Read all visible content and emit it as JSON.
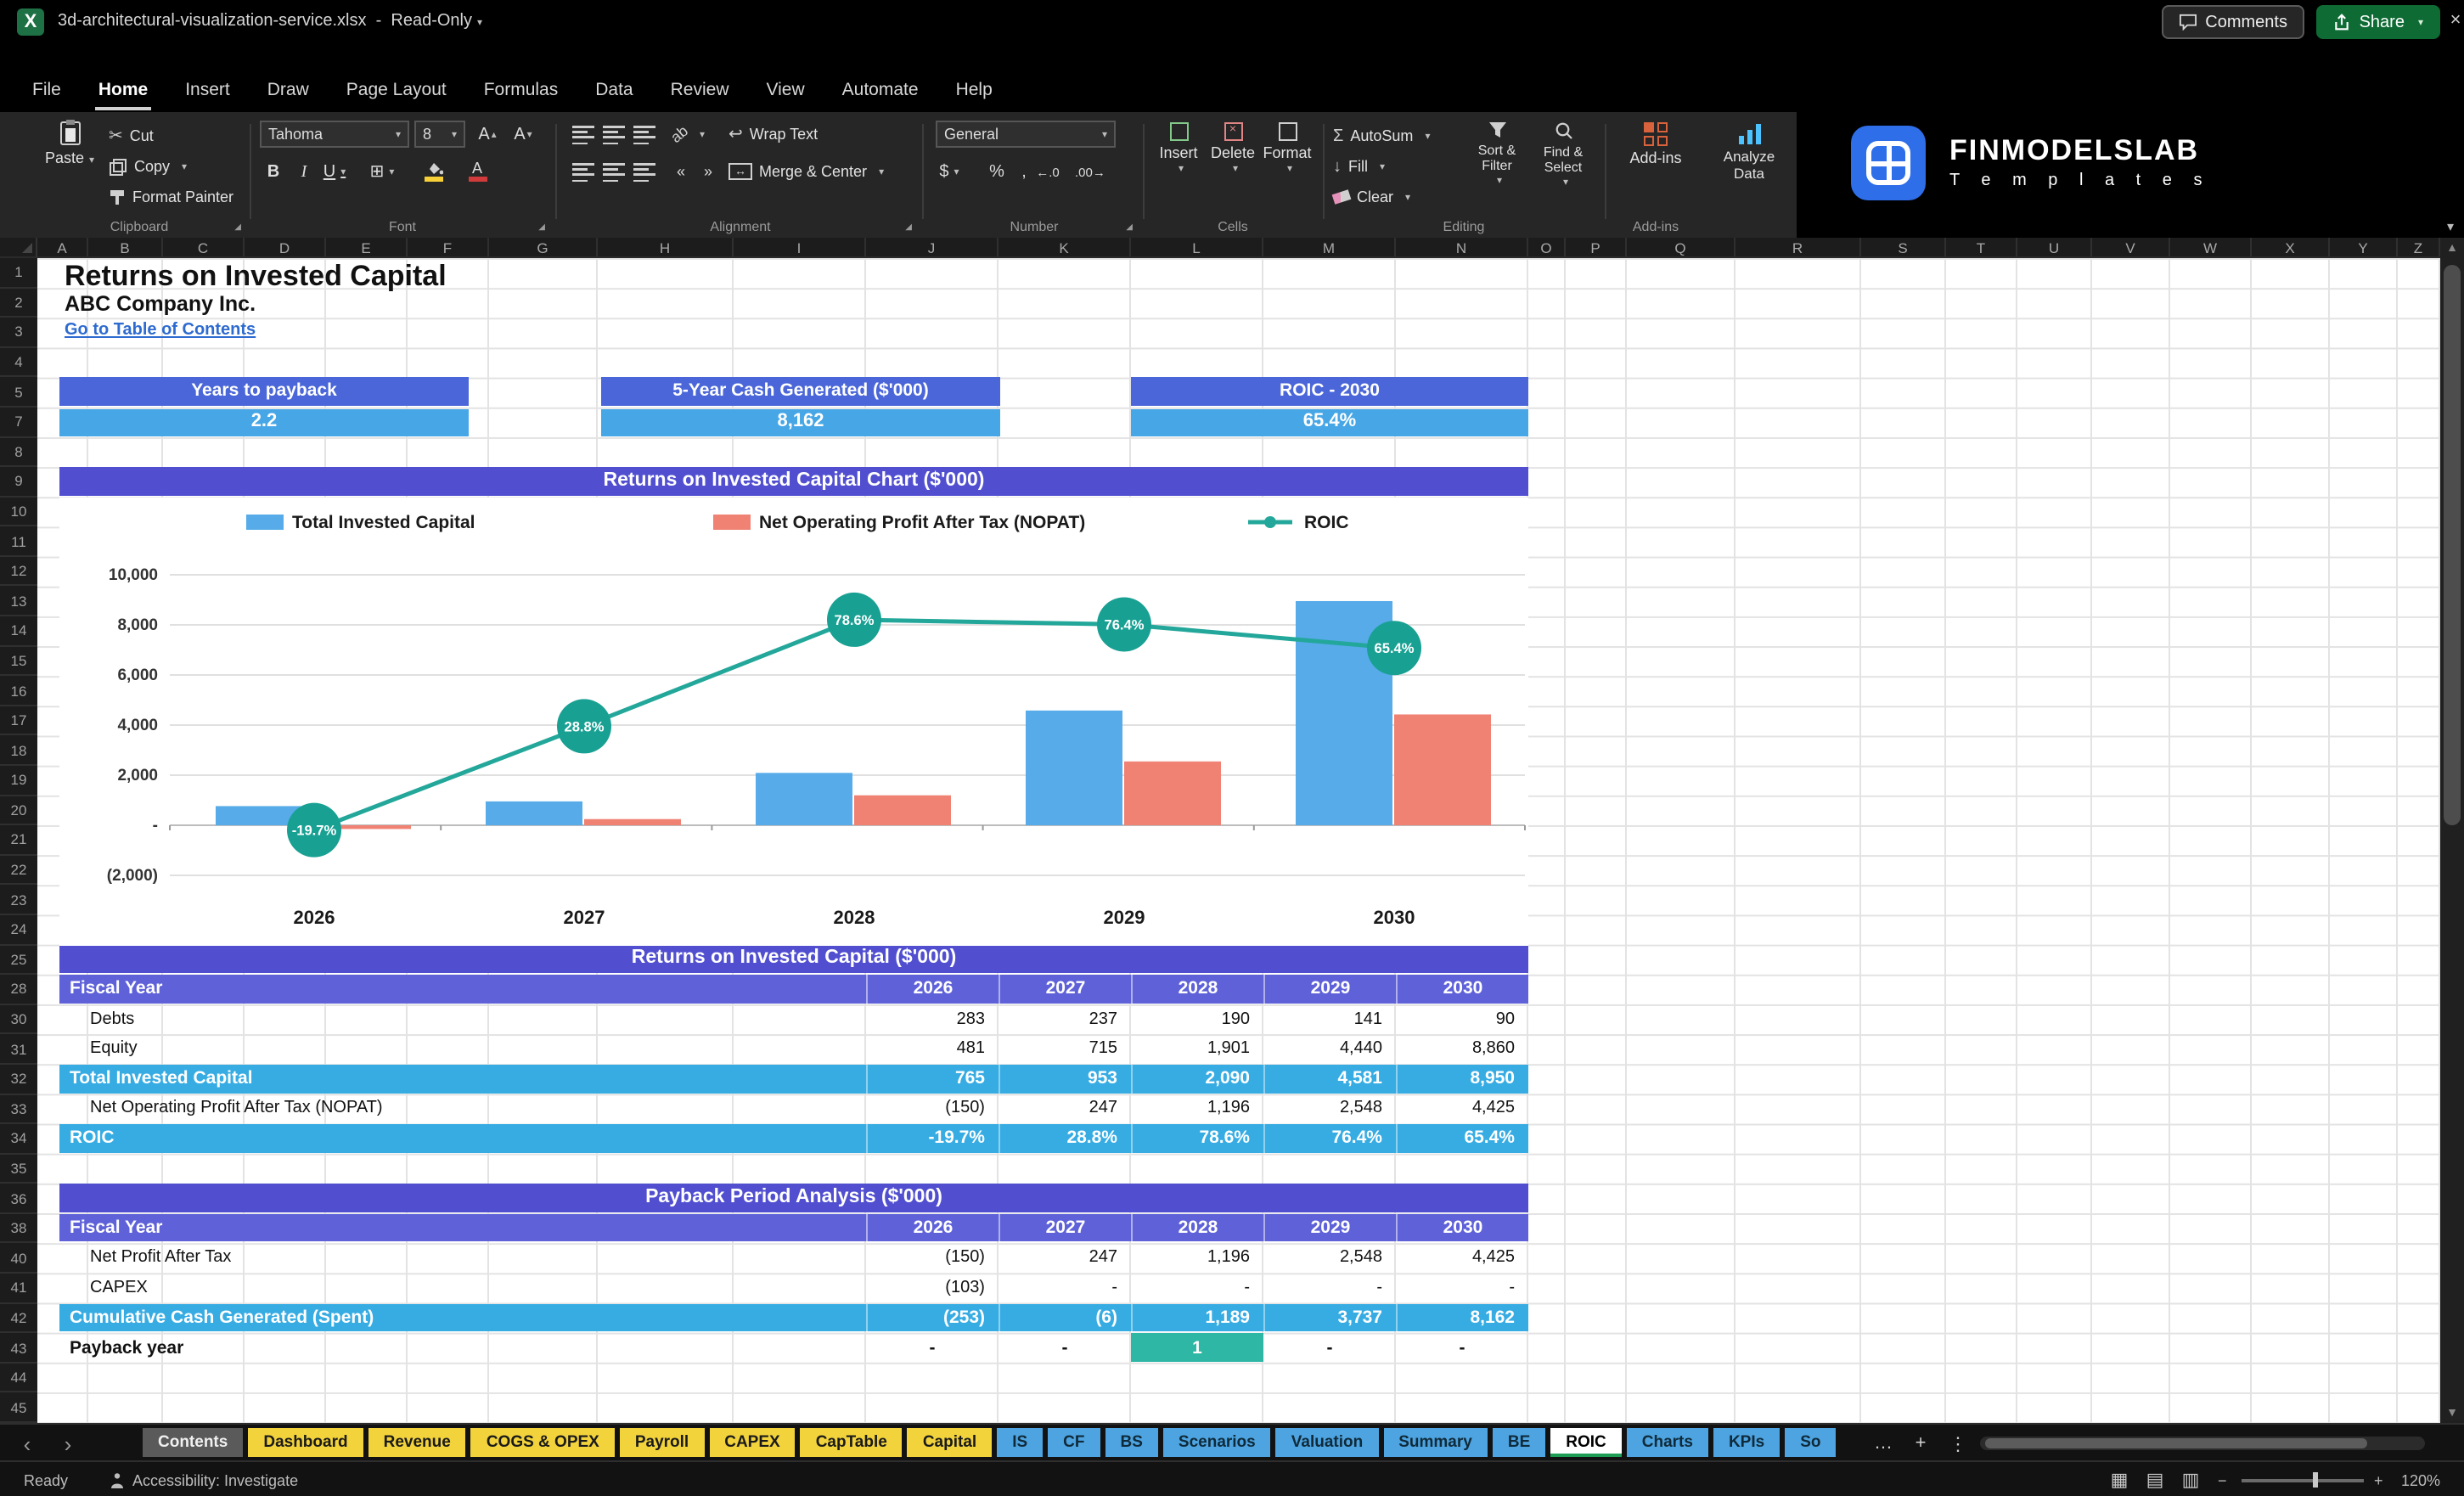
{
  "titlebar": {
    "filename": "3d-architectural-visualization-service.xlsx",
    "mode": "Read-Only"
  },
  "menubar": {
    "items": [
      "File",
      "Home",
      "Insert",
      "Draw",
      "Page Layout",
      "Formulas",
      "Data",
      "Review",
      "View",
      "Automate",
      "Help"
    ],
    "active_item": "Home",
    "comments": "Comments",
    "share": "Share"
  },
  "ribbon": {
    "clipboard": {
      "group": "Clipboard",
      "paste": "Paste",
      "cut": "Cut",
      "copy": "Copy",
      "format_painter": "Format Painter"
    },
    "font": {
      "group": "Font",
      "family": "Tahoma",
      "size": "8"
    },
    "alignment": {
      "group": "Alignment",
      "wrap_text": "Wrap Text",
      "merge_center": "Merge & Center"
    },
    "number": {
      "group": "Number",
      "format": "General",
      "currency": "$",
      "percent": "%",
      "comma": ",",
      "inc_decimal": "←.0",
      "dec_decimal": ".00→"
    },
    "cells": {
      "group": "Cells",
      "insert": "Insert",
      "delete": "Delete",
      "format": "Format"
    },
    "editing": {
      "group": "Editing",
      "autosum": "AutoSum",
      "fill": "Fill",
      "clear": "Clear",
      "sort_filter": "Sort & Filter",
      "find_select": "Find & Select"
    },
    "addins": {
      "group": "Add-ins",
      "addins": "Add-ins",
      "analyze": "Analyze Data"
    }
  },
  "brand": {
    "name": "FINMODELSLAB",
    "tagline": "T e m p l a t e s"
  },
  "sheet": {
    "columns": [
      "A",
      "B",
      "C",
      "D",
      "E",
      "F",
      "G",
      "H",
      "I",
      "J",
      "K",
      "L",
      "M",
      "N",
      "O",
      "P",
      "Q",
      "R",
      "S",
      "T",
      "U",
      "V",
      "W",
      "X",
      "Y",
      "Z"
    ],
    "visible_rows": [
      "1",
      "2",
      "3",
      "4",
      "5",
      "7",
      "8",
      "9",
      "10",
      "11",
      "12",
      "13",
      "14",
      "15",
      "16",
      "17",
      "18",
      "19",
      "20",
      "21",
      "22",
      "23",
      "24",
      "25",
      "28",
      "30",
      "31",
      "32",
      "33",
      "34",
      "35",
      "36",
      "38",
      "40",
      "41",
      "42",
      "43",
      "44",
      "45"
    ],
    "doc_title": "Returns on Invested Capital",
    "company": "ABC Company Inc.",
    "toc_link": "Go to Table of Contents",
    "kpis": [
      {
        "label": "Years to payback",
        "value": "2.2"
      },
      {
        "label": "5-Year Cash Generated ($'000)",
        "value": "8,162"
      },
      {
        "label": "ROIC - 2030",
        "value": "65.4%"
      }
    ],
    "roic_table": {
      "title": "Returns on Invested Capital ($'000)",
      "columns": [
        "Fiscal Year",
        "2026",
        "2027",
        "2028",
        "2029",
        "2030"
      ],
      "rows": [
        {
          "label": "Debts",
          "style": "normal",
          "values": [
            "283",
            "237",
            "190",
            "141",
            "90"
          ]
        },
        {
          "label": "Equity",
          "style": "normal",
          "values": [
            "481",
            "715",
            "1,901",
            "4,440",
            "8,860"
          ]
        },
        {
          "label": "Total Invested Capital",
          "style": "highlight",
          "values": [
            "765",
            "953",
            "2,090",
            "4,581",
            "8,950"
          ]
        },
        {
          "label": "Net Operating Profit After Tax (NOPAT)",
          "style": "normal",
          "values": [
            "(150)",
            "247",
            "1,196",
            "2,548",
            "4,425"
          ]
        },
        {
          "label": "ROIC",
          "style": "highlight",
          "values": [
            "-19.7%",
            "28.8%",
            "78.6%",
            "76.4%",
            "65.4%"
          ]
        }
      ]
    },
    "payback_table": {
      "title": "Payback Period Analysis ($'000)",
      "columns": [
        "Fiscal Year",
        "2026",
        "2027",
        "2028",
        "2029",
        "2030"
      ],
      "rows": [
        {
          "label": "Net Profit After Tax",
          "style": "normal",
          "values": [
            "(150)",
            "247",
            "1,196",
            "2,548",
            "4,425"
          ]
        },
        {
          "label": "CAPEX",
          "style": "normal",
          "values": [
            "(103)",
            "-",
            "-",
            "-",
            "-"
          ]
        },
        {
          "label": "Cumulative Cash Generated (Spent)",
          "style": "highlight",
          "values": [
            "(253)",
            "(6)",
            "1,189",
            "3,737",
            "8,162"
          ]
        },
        {
          "label": "Payback year",
          "style": "payback",
          "values": [
            "-",
            "-",
            "1",
            "-",
            "-"
          ],
          "highlight_col": 2
        }
      ]
    }
  },
  "chart_data": {
    "type": "combo",
    "title": "Returns on Invested Capital Chart ($'000)",
    "categories": [
      "2026",
      "2027",
      "2028",
      "2029",
      "2030"
    ],
    "series": [
      {
        "name": "Total Invested Capital",
        "type": "bar",
        "color": "#56abe8",
        "values": [
          765,
          953,
          2090,
          4581,
          8950
        ]
      },
      {
        "name": "Net Operating Profit After Tax (NOPAT)",
        "type": "bar",
        "color": "#f08274",
        "values": [
          -150,
          247,
          1196,
          2548,
          4425
        ]
      },
      {
        "name": "ROIC",
        "type": "line",
        "color": "#23a79a",
        "marker_color": "#18a093",
        "values_pct": [
          -19.7,
          28.8,
          78.6,
          76.4,
          65.4
        ],
        "labels": [
          "-19.7%",
          "28.8%",
          "78.6%",
          "76.4%",
          "65.4%"
        ]
      }
    ],
    "y_axis": {
      "ticks": [
        "10,000",
        "8,000",
        "6,000",
        "4,000",
        "2,000",
        "-",
        "(2,000)"
      ],
      "tick_values": [
        10000,
        8000,
        6000,
        4000,
        2000,
        0,
        -2000
      ],
      "min": -2000,
      "max": 10000
    },
    "legend_position": "top",
    "gridlines": true
  },
  "sheet_tabs": {
    "nav_left": "‹",
    "nav_right": "›",
    "tabs": [
      {
        "label": "Contents",
        "color": "gray"
      },
      {
        "label": "Dashboard",
        "color": "yellow"
      },
      {
        "label": "Revenue",
        "color": "yellow"
      },
      {
        "label": "COGS & OPEX",
        "color": "yellow"
      },
      {
        "label": "Payroll",
        "color": "yellow"
      },
      {
        "label": "CAPEX",
        "color": "yellow"
      },
      {
        "label": "CapTable",
        "color": "yellow"
      },
      {
        "label": "Capital",
        "color": "yellow"
      },
      {
        "label": "IS",
        "color": "blue"
      },
      {
        "label": "CF",
        "color": "blue"
      },
      {
        "label": "BS",
        "color": "blue"
      },
      {
        "label": "Scenarios",
        "color": "blue"
      },
      {
        "label": "Valuation",
        "color": "blue"
      },
      {
        "label": "Summary",
        "color": "blue"
      },
      {
        "label": "BE",
        "color": "blue"
      },
      {
        "label": "ROIC",
        "color": "active"
      },
      {
        "label": "Charts",
        "color": "blue"
      },
      {
        "label": "KPIs",
        "color": "blue"
      },
      {
        "label": "So",
        "color": "blue"
      }
    ],
    "overflow": "…",
    "add_sheet": "+",
    "menu": "⋮"
  },
  "statusbar": {
    "ready": "Ready",
    "accessibility": "Accessibility: Investigate",
    "zoom": "120%",
    "zoom_out": "−",
    "zoom_in": "+"
  },
  "colors": {
    "kpi_header": "#4a66d8",
    "kpi_value": "#46a6e6",
    "section_header": "#514fd0",
    "table_header": "#5e61d8",
    "highlight_row": "#37ace3",
    "payback_cell": "#2fb7a5",
    "bar_blue": "#56abe8",
    "bar_salmon": "#f08274",
    "line_teal": "#23a79a",
    "tab_yellow": "#f2d33c",
    "tab_blue": "#4da4e0",
    "link": "#2e6bd0"
  }
}
